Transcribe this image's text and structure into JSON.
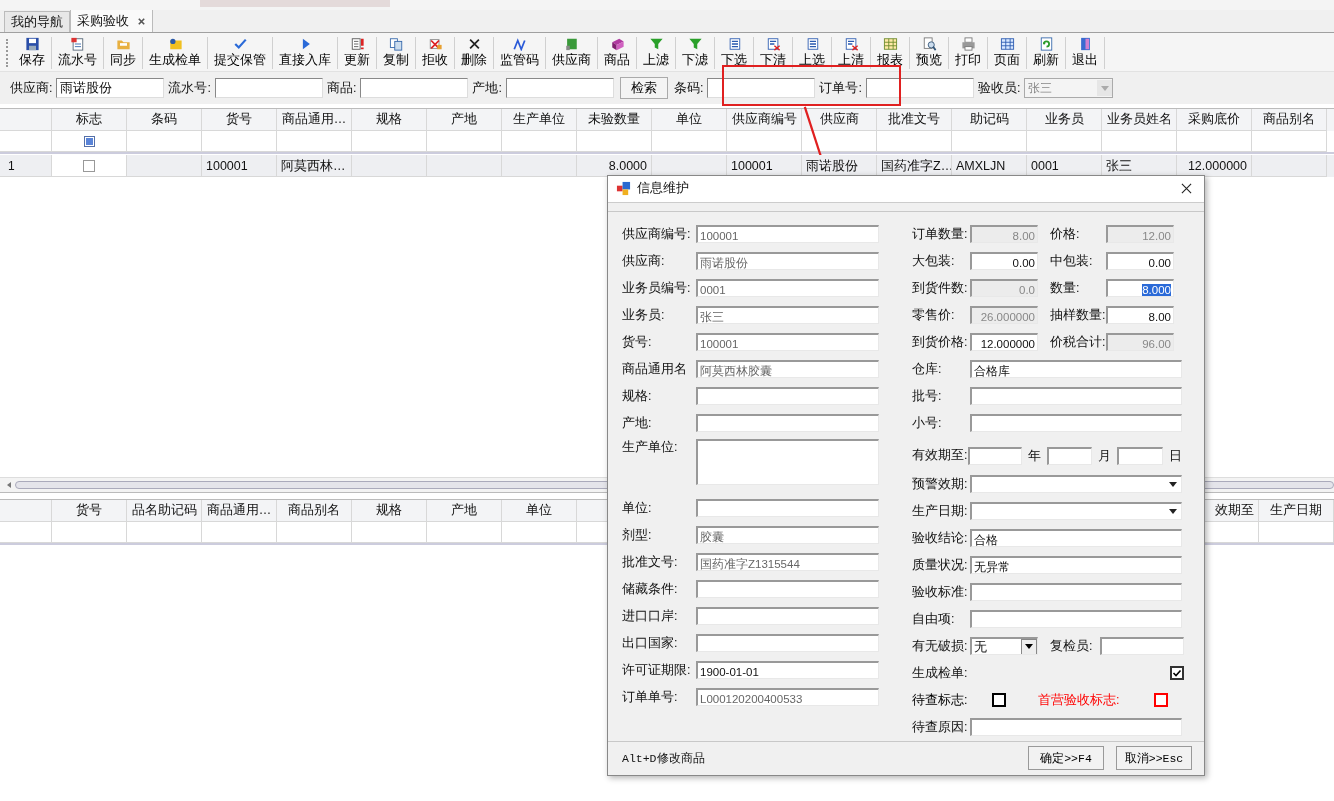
{
  "tabs": [
    {
      "label": "我的导航",
      "selected": false,
      "closable": false
    },
    {
      "label": "采购验收",
      "selected": true,
      "closable": true
    }
  ],
  "toolbar": [
    "保存",
    "流水号",
    "同步",
    "生成检单",
    "提交保管",
    "直接入库",
    "更新",
    "复制",
    "拒收",
    "删除",
    "监管码",
    "供应商",
    "商品",
    "上滤",
    "下滤",
    "下选",
    "下清",
    "上选",
    "上清",
    "报表",
    "预览",
    "打印",
    "页面",
    "刷新",
    "退出"
  ],
  "filter_bar": [
    {
      "kind": "field",
      "label": "供应商:",
      "value": "雨诺股份"
    },
    {
      "kind": "field",
      "label": "流水号:"
    },
    {
      "kind": "field",
      "label": "商品:"
    },
    {
      "kind": "field",
      "label": "产地:"
    },
    {
      "kind": "button",
      "label": "检索"
    },
    {
      "kind": "field",
      "label": "条码:"
    },
    {
      "kind": "field",
      "label": "订单号:"
    },
    {
      "kind": "combo",
      "label": "验收员:",
      "value": "张三",
      "disabled": true
    }
  ],
  "top_grid": {
    "columns": [
      "标志",
      "条码",
      "货号",
      "商品通用…",
      "规格",
      "产地",
      "生产单位",
      "未验数量",
      "单位",
      "供应商编号",
      "供应商",
      "批准文号",
      "助记码",
      "业务员",
      "业务员姓名",
      "采购底价",
      "商品别名"
    ],
    "filter_checked": true,
    "rows": [
      {
        "header": "1",
        "checked": false,
        "cells": [
          "",
          "",
          "100001",
          "阿莫西林…",
          "",
          "",
          "",
          "8.0000",
          "",
          "100001",
          "雨诺股份",
          "国药准字Z…",
          "AMXLJN",
          "0001",
          "张三",
          "12.000000",
          ""
        ]
      }
    ]
  },
  "bottom_grid": {
    "columns": [
      "货号",
      "品名助记码",
      "商品通用…",
      "商品别名",
      "规格",
      "产地",
      "单位"
    ],
    "right_columns": [
      "效期至",
      "生产日期"
    ]
  },
  "dialog": {
    "title": "信息维护",
    "left": [
      {
        "kind": "field",
        "label": "供应商编号:",
        "value": "100001",
        "readonly": true
      },
      {
        "kind": "field",
        "label": "供应商:",
        "value": "雨诺股份",
        "readonly": true
      },
      {
        "kind": "field",
        "label": "业务员编号:",
        "value": "0001",
        "readonly": true
      },
      {
        "kind": "field",
        "label": "业务员:",
        "value": "张三",
        "readonly": true
      },
      {
        "kind": "field",
        "label": "货号:",
        "value": "100001",
        "readonly": true
      },
      {
        "kind": "field",
        "label": "商品通用名",
        "value": "阿莫西林胶囊",
        "readonly": true
      },
      {
        "kind": "field",
        "label": "规格:"
      },
      {
        "kind": "field",
        "label": "产地:"
      },
      {
        "kind": "multiline",
        "label": "生产单位:"
      },
      {
        "kind": "field",
        "label": "单位:"
      },
      {
        "kind": "field",
        "label": "剂型:",
        "value": "胶囊",
        "readonly": true
      },
      {
        "kind": "field",
        "label": "批准文号:",
        "value": "国药准字Z1315544",
        "readonly": true
      },
      {
        "kind": "field",
        "label": "储藏条件:"
      },
      {
        "kind": "field",
        "label": "进口口岸:"
      },
      {
        "kind": "field",
        "label": "出口国家:"
      },
      {
        "kind": "field",
        "label": "许可证期限:",
        "value": "1900-01-01",
        "readonly": false
      },
      {
        "kind": "field",
        "label": "订单单号:",
        "value": "L000120200400533",
        "readonly": true
      }
    ],
    "right": [
      {
        "kind": "pair",
        "fields": [
          {
            "label": "订单数量:",
            "value": "8.00",
            "disabled": true,
            "text_selected": false
          },
          {
            "label": "价格:",
            "value": "12.00",
            "disabled": true,
            "text_selected": false
          }
        ]
      },
      {
        "kind": "pair",
        "fields": [
          {
            "label": "大包装:",
            "value": "0.00",
            "disabled": false,
            "text_selected": false
          },
          {
            "label": "中包装:",
            "value": "0.00",
            "disabled": false,
            "text_selected": false
          }
        ]
      },
      {
        "kind": "pair",
        "fields": [
          {
            "label": "到货件数:",
            "value": "0.0",
            "disabled": true,
            "text_selected": false
          },
          {
            "label": "数量:",
            "value": "8.000",
            "disabled": false,
            "text_selected": true
          }
        ]
      },
      {
        "kind": "pair",
        "fields": [
          {
            "label": "零售价:",
            "value": "26.000000",
            "disabled": true,
            "text_selected": false
          },
          {
            "label": "抽样数量:",
            "value": "8.00",
            "disabled": false,
            "text_selected": false
          }
        ]
      },
      {
        "kind": "pair",
        "fields": [
          {
            "label": "到货价格:",
            "value": "12.000000",
            "disabled": false,
            "text_selected": false
          },
          {
            "label": "价税合计:",
            "value": "96.00",
            "disabled": true,
            "text_selected": false
          }
        ]
      },
      {
        "kind": "field",
        "label": "仓库:",
        "value": "合格库"
      },
      {
        "kind": "field",
        "label": "批号:"
      },
      {
        "kind": "field",
        "label": "小号:"
      },
      {
        "kind": "date",
        "label": "有效期至:",
        "units": [
          "年",
          "月",
          "日"
        ]
      },
      {
        "kind": "dropdown",
        "label": "预警效期:"
      },
      {
        "kind": "dropdown",
        "label": "生产日期:"
      },
      {
        "kind": "field",
        "label": "验收结论:",
        "value": "合格"
      },
      {
        "kind": "field",
        "label": "质量状况:",
        "value": "无异常"
      },
      {
        "kind": "field",
        "label": "验收标准:"
      },
      {
        "kind": "field",
        "label": "自由项:"
      },
      {
        "kind": "combo_field",
        "combo": {
          "label": "有无破损:",
          "value": "无"
        },
        "field": {
          "label": "复检员:"
        }
      },
      {
        "kind": "checkbox",
        "label": "生成检单:",
        "checked": true
      },
      {
        "kind": "checkbox_pair",
        "items": [
          {
            "label": "待查标志:",
            "checked": false,
            "color": "#000000"
          },
          {
            "label": "首营验收标志:",
            "checked": false,
            "color": "#ff0000"
          }
        ]
      },
      {
        "kind": "field",
        "label": "待查原因:"
      }
    ],
    "hint": "Alt+D修改商品",
    "buttons": [
      "确定>>F4",
      "取消>>Esc"
    ]
  }
}
